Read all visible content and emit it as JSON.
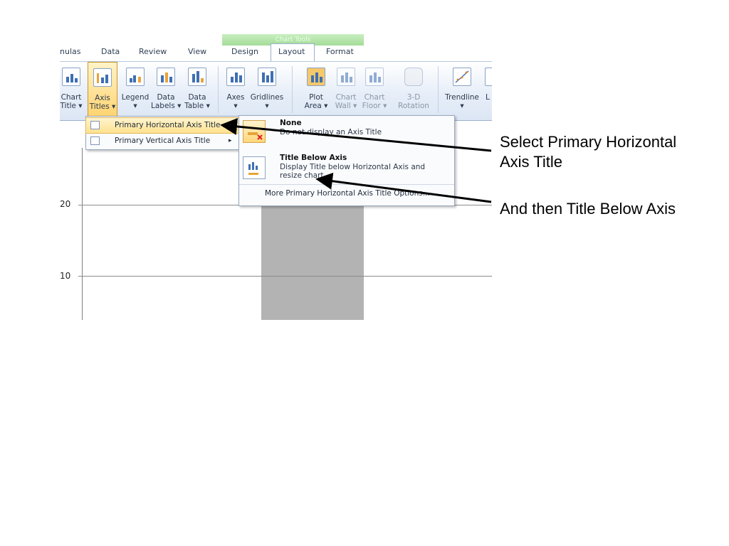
{
  "ribbon": {
    "context_header": "Chart Tools",
    "tabs": [
      "nulas",
      "Data",
      "Review",
      "View",
      "Design",
      "Layout",
      "Format"
    ],
    "buttons": [
      {
        "label1": "Chart",
        "label2": "Title ▾"
      },
      {
        "label1": "Axis",
        "label2": "Titles ▾"
      },
      {
        "label1": "Legend",
        "label2": "▾"
      },
      {
        "label1": "Data",
        "label2": "Labels ▾"
      },
      {
        "label1": "Data",
        "label2": "Table ▾"
      },
      {
        "label1": "Axes",
        "label2": "▾"
      },
      {
        "label1": "Gridlines",
        "label2": "▾"
      },
      {
        "label1": "Plot",
        "label2": "Area ▾"
      },
      {
        "label1": "Chart",
        "label2": "Wall ▾"
      },
      {
        "label1": "Chart",
        "label2": "Floor ▾"
      },
      {
        "label1": "3-D",
        "label2": "Rotation"
      },
      {
        "label1": "Trendline",
        "label2": "▾"
      },
      {
        "label1": "L",
        "label2": ""
      }
    ]
  },
  "axis_titles_menu": {
    "items": [
      {
        "label": "Primary Horizontal Axis Title",
        "icon": "horizontal-axis-title-icon"
      },
      {
        "label": "Primary Vertical Axis Title",
        "icon": "vertical-axis-title-icon"
      }
    ],
    "submenu_arrow": "▸"
  },
  "submenu": {
    "none_title": "None",
    "none_desc": "Do not display an Axis Title",
    "below_title": "Title Below Axis",
    "below_desc": "Display Title below Horizontal Axis and resize chart",
    "more": "More Primary Horizontal Axis Title Options..."
  },
  "chart": {
    "y_ticks": [
      "20",
      "10"
    ],
    "bar_color": "#b3b3b3"
  },
  "annotations": {
    "note1_line1": "Select Primary Horizontal",
    "note1_line2": "Axis Title",
    "note2": "And then Title Below Axis"
  }
}
